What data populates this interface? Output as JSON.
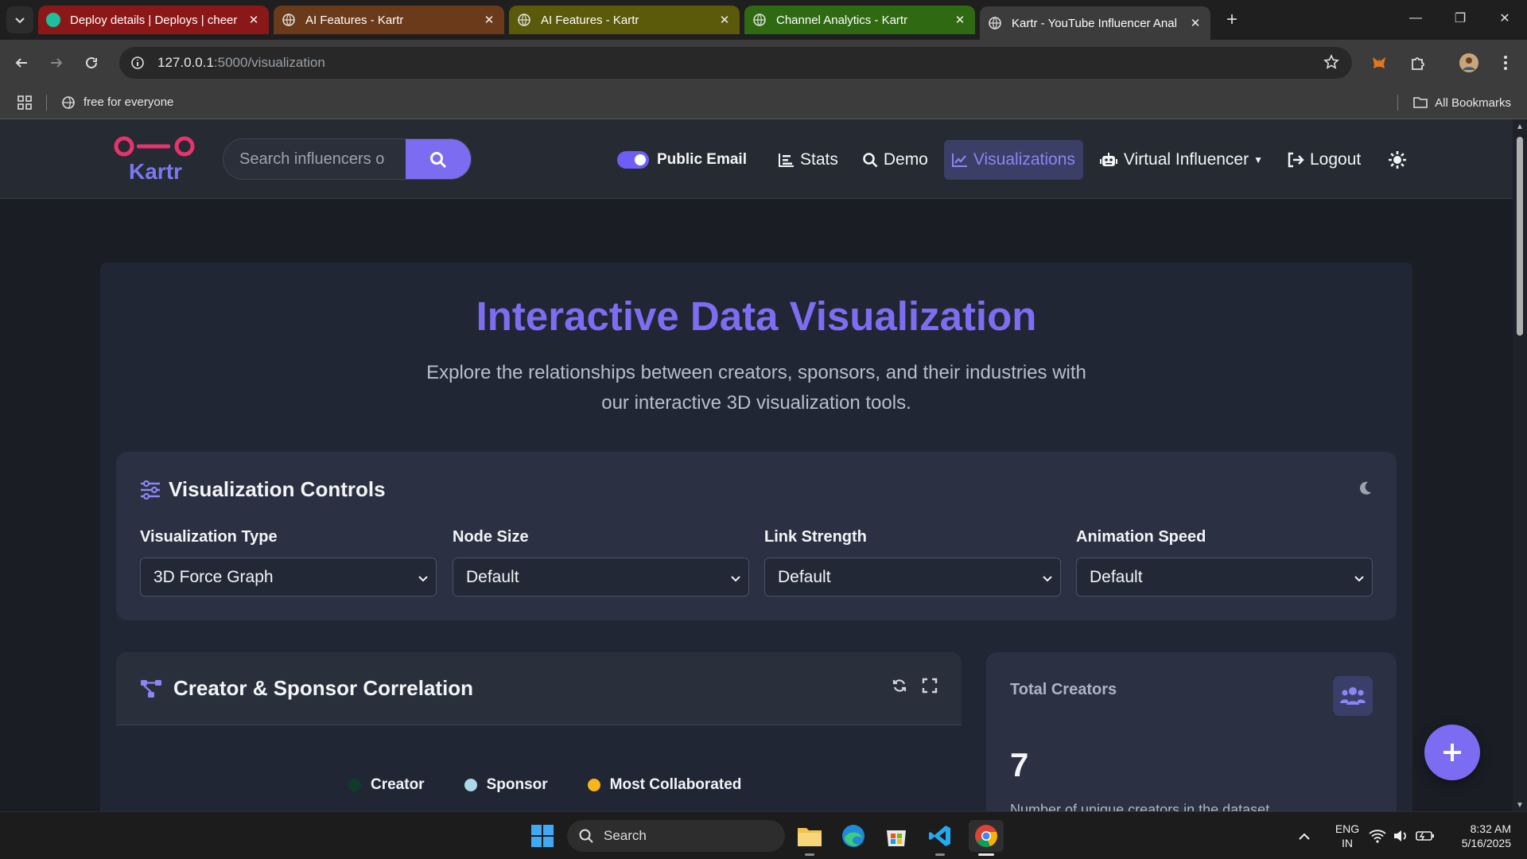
{
  "browser": {
    "tabs": [
      {
        "title": "Deploy details | Deploys | cheer",
        "color": "#8b1818",
        "active": false
      },
      {
        "title": "AI Features - Kartr",
        "color": "#6b3a1a",
        "active": false
      },
      {
        "title": "AI Features - Kartr",
        "color": "#5a5a0a",
        "active": false
      },
      {
        "title": "Channel Analytics - Kartr",
        "color": "#2f6a12",
        "active": false
      },
      {
        "title": "Kartr - YouTube Influencer Anal",
        "color": "#3c3c3c",
        "active": true
      }
    ],
    "url_host": "127.0.0.1",
    "url_path": ":5000/visualization",
    "bookmark": "free for everyone",
    "all_bookmarks": "All Bookmarks"
  },
  "app": {
    "logo_text": "Kartr",
    "search_placeholder": "Search influencers o",
    "nav": {
      "public_email": "Public Email",
      "stats": "Stats",
      "demo": "Demo",
      "visualizations": "Visualizations",
      "virtual_influencer": "Virtual Influencer",
      "logout": "Logout"
    }
  },
  "hero": {
    "title": "Interactive Data Visualization",
    "subtitle": "Explore the relationships between creators, sponsors, and their industries with our interactive 3D visualization tools."
  },
  "controls": {
    "title": "Visualization Controls",
    "fields": [
      {
        "label": "Visualization Type",
        "value": "3D Force Graph"
      },
      {
        "label": "Node Size",
        "value": "Default"
      },
      {
        "label": "Link Strength",
        "value": "Default"
      },
      {
        "label": "Animation Speed",
        "value": "Default"
      }
    ]
  },
  "correlation": {
    "title": "Creator & Sponsor Correlation",
    "legend": [
      {
        "label": "Creator",
        "color": "#0f3b2a"
      },
      {
        "label": "Sponsor",
        "color": "#add8e6"
      },
      {
        "label": "Most Collaborated",
        "color": "#f5b51b"
      }
    ]
  },
  "stat": {
    "label": "Total Creators",
    "value": "7",
    "description": "Number of unique creators in the dataset"
  },
  "taskbar": {
    "search": "Search",
    "lang_top": "ENG",
    "lang_bottom": "IN",
    "time": "8:32 AM",
    "date": "5/16/2025"
  },
  "colors": {
    "accent": "#7c6cf2",
    "background": "#1a1d24",
    "card": "#2b3142"
  }
}
